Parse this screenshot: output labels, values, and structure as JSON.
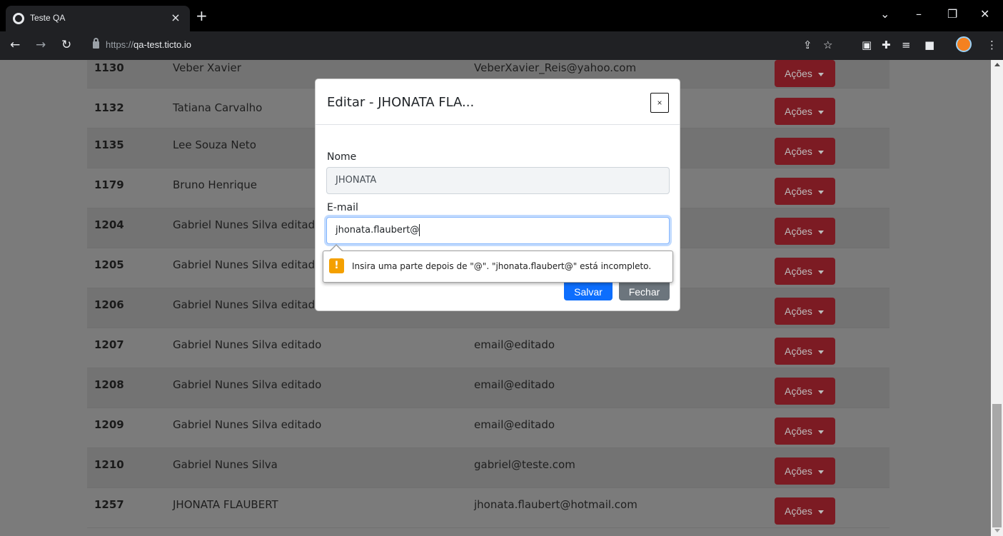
{
  "browser": {
    "tab_title": "Teste QA",
    "tab_close": "×",
    "new_tab": "+",
    "url_prefix": "https://",
    "url_host": "qa-test.ticto.io"
  },
  "table": {
    "action_label": "Ações",
    "rows": [
      {
        "id": "1130",
        "name": "Veber Xavier",
        "email": "VeberXavier_Reis@yahoo.com"
      },
      {
        "id": "1132",
        "name": "Tatiana Carvalho",
        "email": ""
      },
      {
        "id": "1135",
        "name": "Lee Souza Neto",
        "email": ""
      },
      {
        "id": "1179",
        "name": "Bruno Henrique",
        "email": ""
      },
      {
        "id": "1204",
        "name": "Gabriel Nunes Silva editado",
        "email": ""
      },
      {
        "id": "1205",
        "name": "Gabriel Nunes Silva editado",
        "email": ""
      },
      {
        "id": "1206",
        "name": "Gabriel Nunes Silva editado",
        "email": ""
      },
      {
        "id": "1207",
        "name": "Gabriel Nunes Silva editado",
        "email": "email@editado"
      },
      {
        "id": "1208",
        "name": "Gabriel Nunes Silva editado",
        "email": "email@editado"
      },
      {
        "id": "1209",
        "name": "Gabriel Nunes Silva editado",
        "email": "email@editado"
      },
      {
        "id": "1210",
        "name": "Gabriel Nunes Silva",
        "email": "gabriel@teste.com"
      },
      {
        "id": "1257",
        "name": "JHONATA FLAUBERT",
        "email": "jhonata.flaubert@hotmail.com"
      }
    ]
  },
  "modal": {
    "title": "Editar - JHONATA FLA...",
    "close_glyph": "×",
    "name_label": "Nome",
    "name_value": "JHONATA",
    "email_label": "E-mail",
    "email_value": "jhonata.flaubert@",
    "save_label": "Salvar",
    "close_label": "Fechar"
  },
  "validation": {
    "icon": "!",
    "message": "Insira uma parte depois de \"@\". \"jhonata.flaubert@\" está incompleto."
  },
  "colors": {
    "action_button": "#7c1b23",
    "primary": "#0d6efd",
    "secondary": "#6c757d",
    "warning": "#f4a000"
  }
}
